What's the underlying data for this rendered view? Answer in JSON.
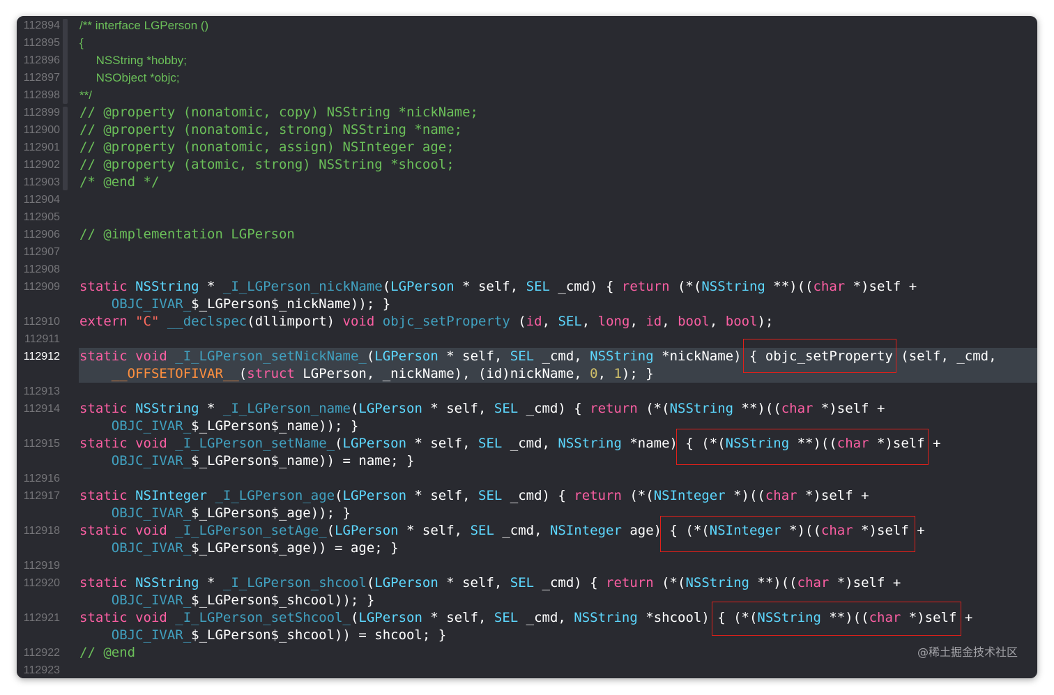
{
  "colors": {
    "background": "#292a30",
    "current_line": "#3b4149",
    "keyword": "#fc5fa3",
    "type": "#5dd8ff",
    "function": "#41a1c0",
    "string": "#fc6a5d",
    "comment": "#6bbf59",
    "number": "#d0bf69",
    "macro": "#fd8f3f",
    "plain": "#ffffff",
    "highlight_box": "#e0201a"
  },
  "current_line_number": "112912",
  "lines": [
    {
      "num": "112894",
      "style": "doc",
      "spans": [
        {
          "c": "c",
          "t": "/** "
        },
        {
          "c": "c",
          "t": "interface LGPerson ()"
        }
      ]
    },
    {
      "num": "112895",
      "style": "doc",
      "spans": [
        {
          "c": "c",
          "t": "{"
        }
      ]
    },
    {
      "num": "112896",
      "style": "doc",
      "spans": [
        {
          "c": "c",
          "t": "     NSString *hobby;"
        }
      ]
    },
    {
      "num": "112897",
      "style": "doc",
      "spans": [
        {
          "c": "c",
          "t": "     NSObject *objc;"
        }
      ]
    },
    {
      "num": "112898",
      "style": "doc",
      "spans": [
        {
          "c": "c",
          "t": "**/"
        }
      ]
    },
    {
      "num": "112899",
      "spans": [
        {
          "c": "c",
          "t": "// @property (nonatomic, copy) NSString *nickName;"
        }
      ]
    },
    {
      "num": "112900",
      "spans": [
        {
          "c": "c",
          "t": "// @property (nonatomic, strong) NSString *name;"
        }
      ]
    },
    {
      "num": "112901",
      "spans": [
        {
          "c": "c",
          "t": "// @property (nonatomic, assign) NSInteger age;"
        }
      ]
    },
    {
      "num": "112902",
      "spans": [
        {
          "c": "c",
          "t": "// @property (atomic, strong) NSString *shcool;"
        }
      ]
    },
    {
      "num": "112903",
      "spans": [
        {
          "c": "c",
          "t": "/* @end */"
        }
      ]
    },
    {
      "num": "112904",
      "spans": []
    },
    {
      "num": "112905",
      "spans": []
    },
    {
      "num": "112906",
      "spans": [
        {
          "c": "c",
          "t": "// @implementation LGPerson"
        }
      ]
    },
    {
      "num": "112907",
      "spans": []
    },
    {
      "num": "112908",
      "spans": []
    },
    {
      "num": "112909",
      "spans": [
        {
          "c": "k",
          "t": "static "
        },
        {
          "c": "t",
          "t": "NSString"
        },
        {
          "c": "p",
          "t": " * "
        },
        {
          "c": "f",
          "t": "_I_LGPerson_nickName"
        },
        {
          "c": "p",
          "t": "("
        },
        {
          "c": "t",
          "t": "LGPerson"
        },
        {
          "c": "p",
          "t": " * self, "
        },
        {
          "c": "t",
          "t": "SEL"
        },
        {
          "c": "p",
          "t": " _cmd) { "
        },
        {
          "c": "k",
          "t": "return"
        },
        {
          "c": "p",
          "t": " (*("
        },
        {
          "c": "t",
          "t": "NSString"
        },
        {
          "c": "p",
          "t": " **)(("
        },
        {
          "c": "k",
          "t": "char"
        },
        {
          "c": "p",
          "t": " *)self +"
        }
      ]
    },
    {
      "num": "",
      "spans": [
        {
          "c": "p",
          "t": "    "
        },
        {
          "c": "f",
          "t": "OBJC_IVAR_"
        },
        {
          "c": "p",
          "t": "$_LGPerson$_nickName)); }"
        }
      ]
    },
    {
      "num": "112910",
      "spans": [
        {
          "c": "k",
          "t": "extern "
        },
        {
          "c": "s",
          "t": "\"C\""
        },
        {
          "c": "p",
          "t": " "
        },
        {
          "c": "f",
          "t": "__declspec"
        },
        {
          "c": "p",
          "t": "(dllimport) "
        },
        {
          "c": "k",
          "t": "void"
        },
        {
          "c": "p",
          "t": " "
        },
        {
          "c": "f",
          "t": "objc_setProperty"
        },
        {
          "c": "p",
          "t": " ("
        },
        {
          "c": "k",
          "t": "id"
        },
        {
          "c": "p",
          "t": ", "
        },
        {
          "c": "t",
          "t": "SEL"
        },
        {
          "c": "p",
          "t": ", "
        },
        {
          "c": "k",
          "t": "long"
        },
        {
          "c": "p",
          "t": ", "
        },
        {
          "c": "k",
          "t": "id"
        },
        {
          "c": "p",
          "t": ", "
        },
        {
          "c": "k",
          "t": "bool"
        },
        {
          "c": "p",
          "t": ", "
        },
        {
          "c": "k",
          "t": "bool"
        },
        {
          "c": "p",
          "t": ");"
        }
      ]
    },
    {
      "num": "112911",
      "spans": []
    },
    {
      "num": "112912",
      "spans": [
        {
          "c": "k",
          "t": "static "
        },
        {
          "c": "k",
          "t": "void"
        },
        {
          "c": "p",
          "t": " "
        },
        {
          "c": "f",
          "t": "_I_LGPerson_setNickName_"
        },
        {
          "c": "p",
          "t": "("
        },
        {
          "c": "t",
          "t": "LGPerson"
        },
        {
          "c": "p",
          "t": " * self, "
        },
        {
          "c": "t",
          "t": "SEL"
        },
        {
          "c": "p",
          "t": " _cmd, "
        },
        {
          "c": "t",
          "t": "NSString"
        },
        {
          "c": "p",
          "t": " *nickName) { objc_setProperty (self, _cmd,"
        }
      ]
    },
    {
      "num": "",
      "spans": [
        {
          "c": "p",
          "t": "    "
        },
        {
          "c": "m",
          "t": "__OFFSETOFIVAR__"
        },
        {
          "c": "p",
          "t": "("
        },
        {
          "c": "k",
          "t": "struct"
        },
        {
          "c": "p",
          "t": " LGPerson, _nickName), (id)nickName, "
        },
        {
          "c": "n",
          "t": "0"
        },
        {
          "c": "p",
          "t": ", "
        },
        {
          "c": "n",
          "t": "1"
        },
        {
          "c": "p",
          "t": "); }"
        }
      ]
    },
    {
      "num": "112913",
      "spans": []
    },
    {
      "num": "112914",
      "spans": [
        {
          "c": "k",
          "t": "static "
        },
        {
          "c": "t",
          "t": "NSString"
        },
        {
          "c": "p",
          "t": " * "
        },
        {
          "c": "f",
          "t": "_I_LGPerson_name"
        },
        {
          "c": "p",
          "t": "("
        },
        {
          "c": "t",
          "t": "LGPerson"
        },
        {
          "c": "p",
          "t": " * self, "
        },
        {
          "c": "t",
          "t": "SEL"
        },
        {
          "c": "p",
          "t": " _cmd) { "
        },
        {
          "c": "k",
          "t": "return"
        },
        {
          "c": "p",
          "t": " (*("
        },
        {
          "c": "t",
          "t": "NSString"
        },
        {
          "c": "p",
          "t": " **)(("
        },
        {
          "c": "k",
          "t": "char"
        },
        {
          "c": "p",
          "t": " *)self +"
        }
      ]
    },
    {
      "num": "",
      "spans": [
        {
          "c": "p",
          "t": "    "
        },
        {
          "c": "f",
          "t": "OBJC_IVAR_"
        },
        {
          "c": "p",
          "t": "$_LGPerson$_name)); }"
        }
      ]
    },
    {
      "num": "112915",
      "spans": [
        {
          "c": "k",
          "t": "static "
        },
        {
          "c": "k",
          "t": "void"
        },
        {
          "c": "p",
          "t": " "
        },
        {
          "c": "f",
          "t": "_I_LGPerson_setName_"
        },
        {
          "c": "p",
          "t": "("
        },
        {
          "c": "t",
          "t": "LGPerson"
        },
        {
          "c": "p",
          "t": " * self, "
        },
        {
          "c": "t",
          "t": "SEL"
        },
        {
          "c": "p",
          "t": " _cmd, "
        },
        {
          "c": "t",
          "t": "NSString"
        },
        {
          "c": "p",
          "t": " *name) { (*("
        },
        {
          "c": "t",
          "t": "NSString"
        },
        {
          "c": "p",
          "t": " **)(("
        },
        {
          "c": "k",
          "t": "char"
        },
        {
          "c": "p",
          "t": " *)self +"
        }
      ]
    },
    {
      "num": "",
      "spans": [
        {
          "c": "p",
          "t": "    "
        },
        {
          "c": "f",
          "t": "OBJC_IVAR_"
        },
        {
          "c": "p",
          "t": "$_LGPerson$_name)) = name; }"
        }
      ]
    },
    {
      "num": "112916",
      "spans": []
    },
    {
      "num": "112917",
      "spans": [
        {
          "c": "k",
          "t": "static "
        },
        {
          "c": "t",
          "t": "NSInteger"
        },
        {
          "c": "p",
          "t": " "
        },
        {
          "c": "f",
          "t": "_I_LGPerson_age"
        },
        {
          "c": "p",
          "t": "("
        },
        {
          "c": "t",
          "t": "LGPerson"
        },
        {
          "c": "p",
          "t": " * self, "
        },
        {
          "c": "t",
          "t": "SEL"
        },
        {
          "c": "p",
          "t": " _cmd) { "
        },
        {
          "c": "k",
          "t": "return"
        },
        {
          "c": "p",
          "t": " (*("
        },
        {
          "c": "t",
          "t": "NSInteger"
        },
        {
          "c": "p",
          "t": " *)(("
        },
        {
          "c": "k",
          "t": "char"
        },
        {
          "c": "p",
          "t": " *)self +"
        }
      ]
    },
    {
      "num": "",
      "spans": [
        {
          "c": "p",
          "t": "    "
        },
        {
          "c": "f",
          "t": "OBJC_IVAR_"
        },
        {
          "c": "p",
          "t": "$_LGPerson$_age)); }"
        }
      ]
    },
    {
      "num": "112918",
      "spans": [
        {
          "c": "k",
          "t": "static "
        },
        {
          "c": "k",
          "t": "void"
        },
        {
          "c": "p",
          "t": " "
        },
        {
          "c": "f",
          "t": "_I_LGPerson_setAge_"
        },
        {
          "c": "p",
          "t": "("
        },
        {
          "c": "t",
          "t": "LGPerson"
        },
        {
          "c": "p",
          "t": " * self, "
        },
        {
          "c": "t",
          "t": "SEL"
        },
        {
          "c": "p",
          "t": " _cmd, "
        },
        {
          "c": "t",
          "t": "NSInteger"
        },
        {
          "c": "p",
          "t": " age) { (*("
        },
        {
          "c": "t",
          "t": "NSInteger"
        },
        {
          "c": "p",
          "t": " *)(("
        },
        {
          "c": "k",
          "t": "char"
        },
        {
          "c": "p",
          "t": " *)self +"
        }
      ]
    },
    {
      "num": "",
      "spans": [
        {
          "c": "p",
          "t": "    "
        },
        {
          "c": "f",
          "t": "OBJC_IVAR_"
        },
        {
          "c": "p",
          "t": "$_LGPerson$_age)) = age; }"
        }
      ]
    },
    {
      "num": "112919",
      "spans": []
    },
    {
      "num": "112920",
      "spans": [
        {
          "c": "k",
          "t": "static "
        },
        {
          "c": "t",
          "t": "NSString"
        },
        {
          "c": "p",
          "t": " * "
        },
        {
          "c": "f",
          "t": "_I_LGPerson_shcool"
        },
        {
          "c": "p",
          "t": "("
        },
        {
          "c": "t",
          "t": "LGPerson"
        },
        {
          "c": "p",
          "t": " * self, "
        },
        {
          "c": "t",
          "t": "SEL"
        },
        {
          "c": "p",
          "t": " _cmd) { "
        },
        {
          "c": "k",
          "t": "return"
        },
        {
          "c": "p",
          "t": " (*("
        },
        {
          "c": "t",
          "t": "NSString"
        },
        {
          "c": "p",
          "t": " **)(("
        },
        {
          "c": "k",
          "t": "char"
        },
        {
          "c": "p",
          "t": " *)self +"
        }
      ]
    },
    {
      "num": "",
      "spans": [
        {
          "c": "p",
          "t": "    "
        },
        {
          "c": "f",
          "t": "OBJC_IVAR_"
        },
        {
          "c": "p",
          "t": "$_LGPerson$_shcool)); }"
        }
      ]
    },
    {
      "num": "112921",
      "spans": [
        {
          "c": "k",
          "t": "static "
        },
        {
          "c": "k",
          "t": "void"
        },
        {
          "c": "p",
          "t": " "
        },
        {
          "c": "f",
          "t": "_I_LGPerson_setShcool_"
        },
        {
          "c": "p",
          "t": "("
        },
        {
          "c": "t",
          "t": "LGPerson"
        },
        {
          "c": "p",
          "t": " * self, "
        },
        {
          "c": "t",
          "t": "SEL"
        },
        {
          "c": "p",
          "t": " _cmd, "
        },
        {
          "c": "t",
          "t": "NSString"
        },
        {
          "c": "p",
          "t": " *shcool) { (*("
        },
        {
          "c": "t",
          "t": "NSString"
        },
        {
          "c": "p",
          "t": " **)(("
        },
        {
          "c": "k",
          "t": "char"
        },
        {
          "c": "p",
          "t": " *)self +"
        }
      ]
    },
    {
      "num": "",
      "spans": [
        {
          "c": "p",
          "t": "    "
        },
        {
          "c": "f",
          "t": "OBJC_IVAR_"
        },
        {
          "c": "p",
          "t": "$_LGPerson$_shcool)) = shcool; }"
        }
      ]
    },
    {
      "num": "112922",
      "spans": [
        {
          "c": "c",
          "t": "// @end"
        }
      ]
    },
    {
      "num": "112923",
      "spans": []
    }
  ],
  "watermark": "@稀土掘金技术社区"
}
